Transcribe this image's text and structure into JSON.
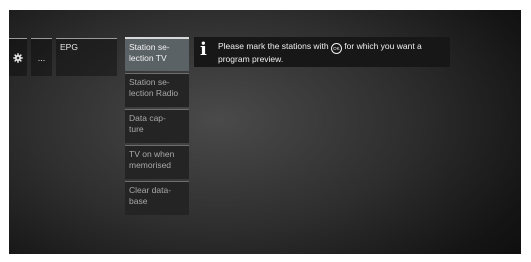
{
  "tabs": {
    "gear_icon": "gear-icon",
    "more_label": "...",
    "epg_label": "EPG"
  },
  "menu": {
    "items": [
      {
        "label": "Station se-\nlection TV",
        "selected": true
      },
      {
        "label": "Station se-\nlection Radio",
        "selected": false
      },
      {
        "label": "Data cap-\nture",
        "selected": false
      },
      {
        "label": "TV on when\nmemorised",
        "selected": false
      },
      {
        "label": "Clear data-\nbase",
        "selected": false
      }
    ]
  },
  "info": {
    "icon": "info-icon",
    "text_before": "Please mark the stations with ",
    "ok_symbol": "OK",
    "text_after": " for which you want a program preview."
  },
  "colors": {
    "selected_item": "#5b6266",
    "menu_item": "#242424",
    "info_box": "#171717"
  }
}
